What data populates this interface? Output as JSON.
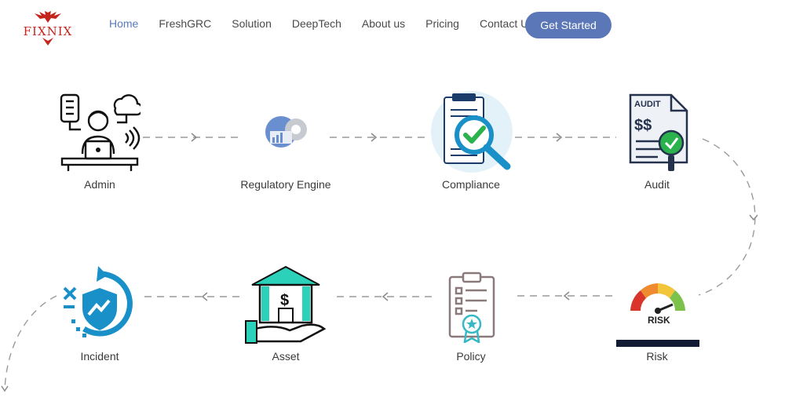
{
  "logo": {
    "text": "FIXNIX"
  },
  "nav": {
    "items": [
      "Home",
      "FreshGRC",
      "Solution",
      "DeepTech",
      "About us",
      "Pricing",
      "Contact Us"
    ],
    "active_index": 0
  },
  "cta": {
    "label": "Get Started"
  },
  "steps": {
    "admin": "Admin",
    "regulatory": "Regulatory Engine",
    "compliance": "Compliance",
    "audit": "Audit",
    "incident": "Incident",
    "asset": "Asset",
    "policy": "Policy",
    "risk": "Risk"
  },
  "icon_text": {
    "audit_header": "AUDIT",
    "audit_dollars": "$$",
    "risk": "RISK",
    "asset_dollar": "$"
  },
  "colors": {
    "brand_red": "#c4261d",
    "nav_active": "#5a7ab8",
    "cta_bg": "#5b77b7",
    "connector": "#9a9a9a",
    "teal": "#1aa7b7",
    "mint": "#2bd1b9",
    "green_check": "#2bb24c"
  }
}
